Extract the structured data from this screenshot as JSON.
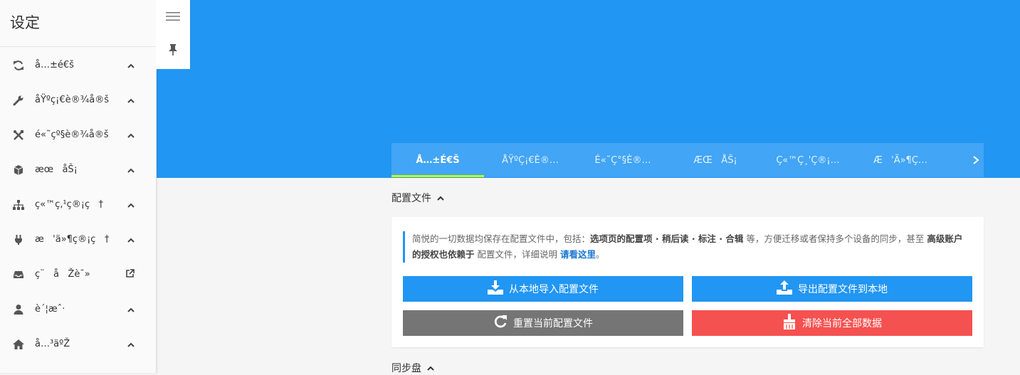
{
  "sidebar": {
    "title": "设定",
    "items": [
      {
        "icon": "sync-icon",
        "label": "å…±é€š",
        "indicator": "⌃"
      },
      {
        "icon": "wrench-icon",
        "label": "åŸºç¡€è®¾å®š",
        "indicator": "⌃"
      },
      {
        "icon": "tools-icon",
        "label": "é«˜çº§è®¾å®š",
        "indicator": "⌃"
      },
      {
        "icon": "cube-icon",
        "label": "æœ   åŠ¡",
        "indicator": "⌃"
      },
      {
        "icon": "sitemap-icon",
        "label": "ç«™ç‚¹ç®¡ç   †",
        "indicator": "⌃"
      },
      {
        "icon": "plug-icon",
        "label": "æ   'ä»¶ç®¡ç   †",
        "indicator": "⌃"
      },
      {
        "icon": "inbox-icon",
        "label": "ç¨   å   Žè¯»",
        "indicator": "external-link-icon"
      },
      {
        "icon": "user-icon",
        "label": "è´¦æˆ·",
        "indicator": "⌃"
      },
      {
        "icon": "home-icon",
        "label": "å…³äºŽ",
        "indicator": "⌃"
      }
    ]
  },
  "toolbar": {
    "menu_icon": "menu-icon",
    "pin_icon": "pin-icon"
  },
  "tabs": [
    {
      "label": "Å…±É€Š",
      "active": true
    },
    {
      "label": "ÅŸºÇ¡€È®…",
      "active": false
    },
    {
      "label": "É«˜Ç°§È®…",
      "active": false
    },
    {
      "label": "ÆŒ   ÅŠ¡",
      "active": false
    },
    {
      "label": "Ç«™Ç¸'Ç®¡…",
      "active": false
    },
    {
      "label": "Æ   'Ä»¶Ç…",
      "active": false
    }
  ],
  "sections": {
    "config_title": "配置文件",
    "sync_title": "同步盘"
  },
  "description": {
    "p1": "简悦的一切数据均保存在配置文件中，包括：",
    "b1": "选项页的配置项 · 稍后读 · 标注 · 合辑",
    "p2": " 等，方便迁移或者保持多个设备的同步，甚至 ",
    "b2": "高级账户的授权也依赖于",
    "p3": " 配置文件，详细说明 ",
    "link": "请看这里",
    "p4": "。"
  },
  "buttons": {
    "import": "从本地导入配置文件",
    "export": "导出配置文件到本地",
    "reset": "重置当前配置文件",
    "clear": "清除当前全部数据"
  },
  "colors": {
    "header": "#2196f3",
    "tab_bar": "#42a5f5",
    "tab_indicator": "#c6ff00",
    "btn_blue": "#2196f3",
    "btn_grey": "#757575",
    "btn_red": "#f55151"
  }
}
